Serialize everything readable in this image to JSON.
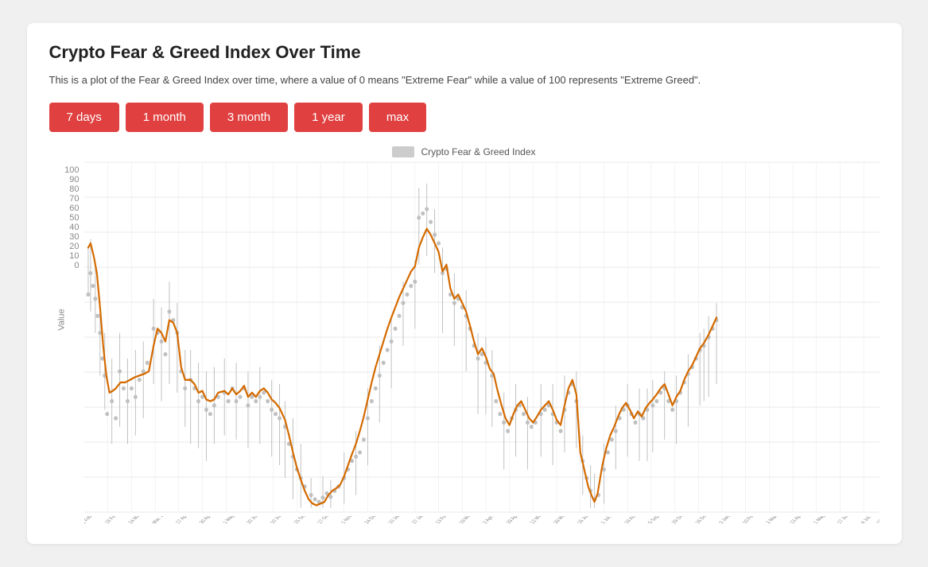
{
  "page": {
    "title": "Crypto Fear & Greed Index Over Time",
    "subtitle": "This is a plot of the Fear & Greed Index over time, where a value of 0 means \"Extreme Fear\" while a value of 100 represents \"Extreme Greed\".",
    "buttons": [
      {
        "label": "7 days",
        "id": "btn-7days"
      },
      {
        "label": "1 month",
        "id": "btn-1month"
      },
      {
        "label": "3 month",
        "id": "btn-3month"
      },
      {
        "label": "1 year",
        "id": "btn-1year"
      },
      {
        "label": "max",
        "id": "btn-max"
      }
    ],
    "legend_label": "Crypto Fear & Greed Index",
    "y_axis_label": "Value",
    "y_ticks": [
      "100",
      "90",
      "80",
      "70",
      "60",
      "50",
      "40",
      "30",
      "20",
      "10",
      "0"
    ],
    "colors": {
      "accent": "#e04040",
      "line": "#d46a00",
      "scatter": "#bbb"
    }
  }
}
